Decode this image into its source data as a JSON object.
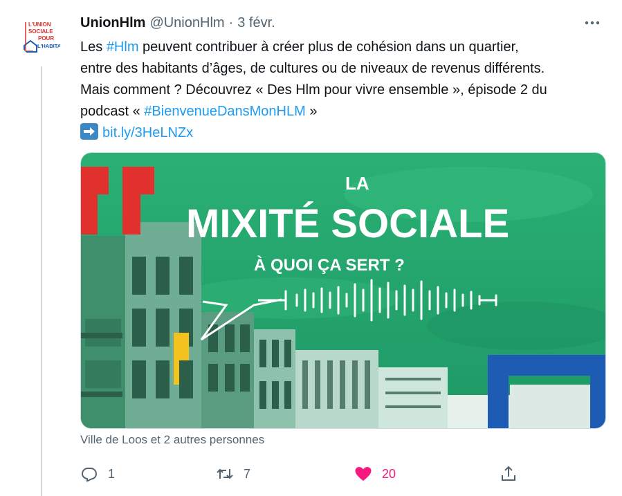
{
  "tweet": {
    "author_name": "UnionHlm",
    "author_handle": "@UnionHlm",
    "separator": "·",
    "date": "3 févr.",
    "avatar_lines": [
      "L'UNION",
      "SOCIALE",
      "POUR",
      "L'HABITAT"
    ],
    "text_line1_pre": "Les ",
    "text_line1_tag": "#Hlm",
    "text_line1_post": " peuvent contribuer à créer plus de cohésion dans un quartier,",
    "text_line2": "entre des habitants d’âges, de cultures ou de niveaux de revenus différents.",
    "text_line3": "Mais comment ? Découvrez « Des Hlm pour vivre ensemble », épisode 2 du",
    "text_line4_pre": "podcast « ",
    "text_line4_tag": "#BienvenueDansMonHLM",
    "text_line4_post": " »",
    "link": "bit.ly/3HeLNZx"
  },
  "media": {
    "line1": "LA",
    "line2_a": "MIXITÉ",
    "line2_b": "SOCIALE",
    "line3": "À QUOI ÇA SERT ?"
  },
  "liked_by": "Ville de Loos et 2 autres personnes",
  "actions": {
    "reply_count": "1",
    "retweet_count": "7",
    "like_count": "20"
  },
  "colors": {
    "text": "#0f1419",
    "secondary": "#536471",
    "link": "#1d9bf0",
    "like": "#f91880",
    "media_green": "#23a36f",
    "quote_red": "#e0312c",
    "frame_blue": "#1d5bb5"
  },
  "icons": {
    "more": "more-horizontal-icon",
    "reply": "reply-icon",
    "retweet": "retweet-icon",
    "like": "heart-filled-icon",
    "share": "share-icon",
    "arrow": "right-arrow-emoji-icon"
  }
}
